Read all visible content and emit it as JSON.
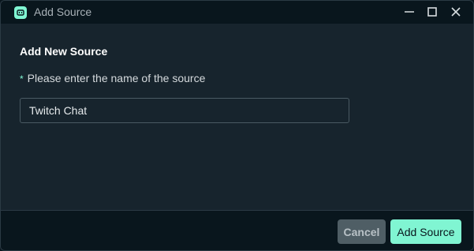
{
  "window": {
    "title": "Add Source",
    "controls": {
      "minimize_icon": "minimize-icon",
      "maximize_icon": "maximize-icon",
      "close_icon": "close-icon"
    }
  },
  "form": {
    "heading": "Add New Source",
    "required_mark": "*",
    "label": "Please enter the name of the source",
    "input_value": "Twitch Chat"
  },
  "footer": {
    "cancel_label": "Cancel",
    "add_label": "Add Source"
  },
  "colors": {
    "accent": "#80f5d2",
    "background": "#17242d",
    "titlebar": "#09161d",
    "cancel_button": "#4f5e65"
  }
}
